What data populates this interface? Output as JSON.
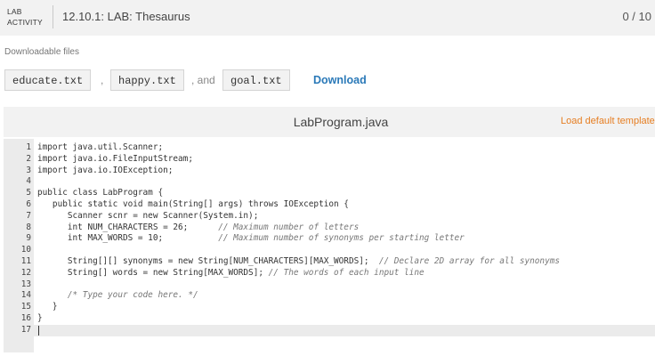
{
  "header": {
    "badge_line1": "LAB",
    "badge_line2": "ACTIVITY",
    "title": "12.10.1: LAB: Thesaurus",
    "score": "0 / 10"
  },
  "downloads": {
    "label": "Downloadable files",
    "files": [
      "educate.txt",
      "happy.txt",
      "goal.txt"
    ],
    "separator1": ",",
    "separator2": ", and",
    "download_label": "Download"
  },
  "editor": {
    "filename": "LabProgram.java",
    "load_default_label": "Load default template...",
    "lines": [
      {
        "num": "1",
        "code": "import java.util.Scanner;",
        "comment": ""
      },
      {
        "num": "2",
        "code": "import java.io.FileInputStream;",
        "comment": ""
      },
      {
        "num": "3",
        "code": "import java.io.IOException;",
        "comment": ""
      },
      {
        "num": "4",
        "code": "",
        "comment": ""
      },
      {
        "num": "5",
        "code": "public class LabProgram {",
        "comment": ""
      },
      {
        "num": "6",
        "code": "   public static void main(String[] args) throws IOException {",
        "comment": ""
      },
      {
        "num": "7",
        "code": "      Scanner scnr = new Scanner(System.in);",
        "comment": ""
      },
      {
        "num": "8",
        "code": "      int NUM_CHARACTERS = 26;      ",
        "comment": "// Maximum number of letters"
      },
      {
        "num": "9",
        "code": "      int MAX_WORDS = 10;           ",
        "comment": "// Maximum number of synonyms per starting letter"
      },
      {
        "num": "10",
        "code": "",
        "comment": ""
      },
      {
        "num": "11",
        "code": "      String[][] synonyms = new String[NUM_CHARACTERS][MAX_WORDS];  ",
        "comment": "// Declare 2D array for all synonyms"
      },
      {
        "num": "12",
        "code": "      String[] words = new String[MAX_WORDS]; ",
        "comment": "// The words of each input line"
      },
      {
        "num": "13",
        "code": "",
        "comment": ""
      },
      {
        "num": "14",
        "code": "      ",
        "comment": "/* Type your code here. */"
      },
      {
        "num": "15",
        "code": "   }",
        "comment": ""
      },
      {
        "num": "16",
        "code": "}",
        "comment": ""
      },
      {
        "num": "17",
        "code": "",
        "comment": ""
      }
    ]
  }
}
